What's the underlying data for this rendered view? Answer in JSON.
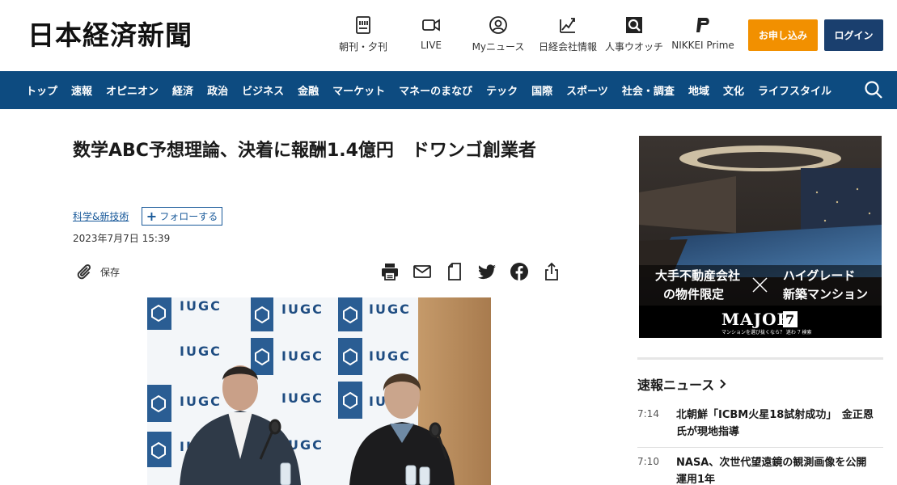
{
  "header": {
    "logo": "日本経済新聞",
    "nav": [
      {
        "label": "朝刊・夕刊",
        "icon": "newspaper-icon"
      },
      {
        "label": "LIVE",
        "icon": "video-camera-icon"
      },
      {
        "label": "Myニュース",
        "icon": "user-icon"
      },
      {
        "label": "日経会社情報",
        "icon": "chart-icon"
      },
      {
        "label": "人事ウオッチ",
        "icon": "magnifier-icon"
      },
      {
        "label": "NIKKEI Prime",
        "icon": "prime-logo-icon"
      }
    ],
    "subscribe": "お申し込み",
    "login": "ログイン"
  },
  "navbar": {
    "items": [
      "トップ",
      "速報",
      "オピニオン",
      "経済",
      "政治",
      "ビジネス",
      "金融",
      "マーケット",
      "マネーのまなび",
      "テック",
      "国際",
      "スポーツ",
      "社会・調査",
      "地域",
      "文化",
      "ライフスタイル"
    ]
  },
  "article": {
    "title": "数学ABC予想理論、決着に報酬1.4億円　ドワンゴ創業者",
    "topic": "科学&新技術",
    "follow": "フォローする",
    "date": "2023年7月7日 15:39",
    "save": "保存",
    "photo_banner_text": "IUGC"
  },
  "ad": {
    "line1a": "大手不動産会社",
    "line1b": "の物件限定",
    "line2a": "ハイグレード",
    "line2b": "新築マンション",
    "brand": "MAJOR",
    "brand_num": "7",
    "tagline": "マンションを選び抜くなら？ 迷わ 7 検索"
  },
  "sidebar": {
    "breaking_title": "速報ニュース",
    "items": [
      {
        "time": "7:14",
        "headline": "北朝鮮「ICBM火星18試射成功」　金正恩氏が現地指導"
      },
      {
        "time": "7:10",
        "headline": "NASA、次世代望遠鏡の観測画像を公開　運用1年"
      }
    ]
  },
  "colors": {
    "nav_bg": "#0d4b80",
    "subscribe_bg": "#f29000",
    "login_bg": "#1a3f6e",
    "link": "#1a5a9a"
  }
}
